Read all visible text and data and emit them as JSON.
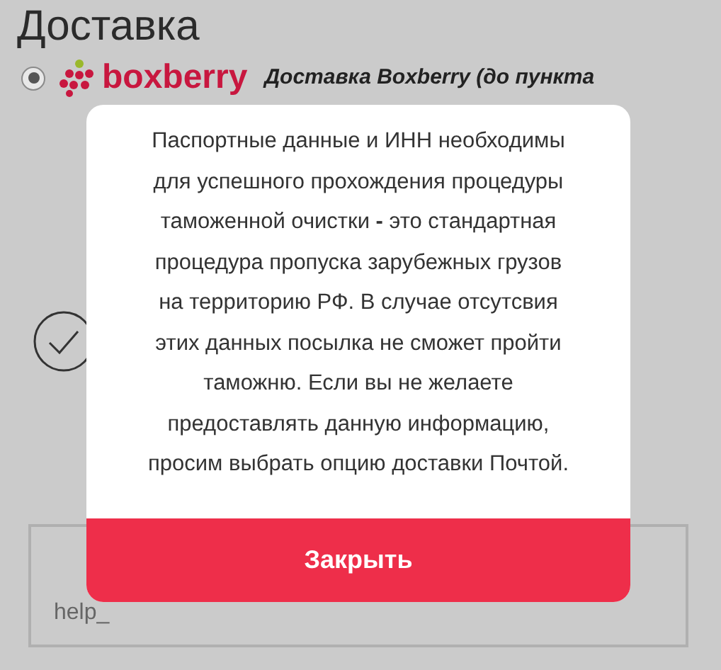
{
  "page": {
    "heading": "Доставка"
  },
  "delivery_options": [
    {
      "selected": true,
      "logo_text": "boxberry",
      "label": "Доставка Boxberry (до пункта"
    }
  ],
  "email_field": {
    "value": "help_"
  },
  "modal": {
    "lines": [
      "Паспортные данные и ИНН необходимы",
      "для успешного прохождения процедуры",
      "таможенной очистки **-** это стандартная",
      "процедура пропуска зарубежных грузов",
      "на территорию РФ. В случае отсутсвия",
      "этих данных посылка не сможет пройти",
      "таможню. Если вы не желаете",
      "предоставлять данную информацию,",
      "просим выбрать опцию доставки Почтой."
    ],
    "close_button": "Закрыть"
  }
}
